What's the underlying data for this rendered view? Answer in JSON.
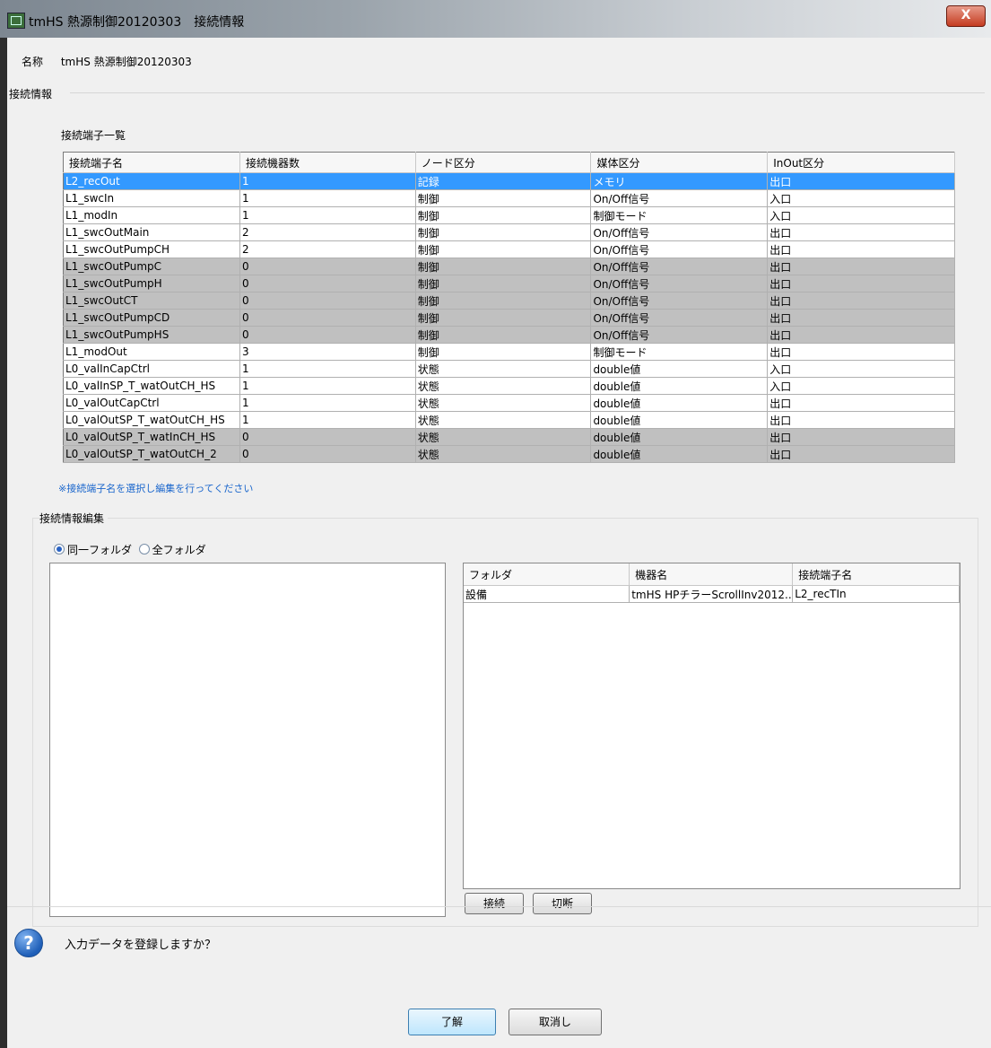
{
  "window": {
    "title": "tmHS 熱源制御20120303　接続情報",
    "close_label": "X"
  },
  "name_row": {
    "label": "名称",
    "value": "tmHS 熱源制御20120303"
  },
  "group_connection_info": "接続情報",
  "terminal_list": {
    "title": "接続端子一覧",
    "columns": [
      "接続端子名",
      "接続機器数",
      "ノード区分",
      "媒体区分",
      "InOut区分"
    ],
    "rows": [
      [
        "L2_recOut",
        "1",
        "記録",
        "メモリ",
        "出口"
      ],
      [
        "L1_swcIn",
        "1",
        "制御",
        "On/Off信号",
        "入口"
      ],
      [
        "L1_modIn",
        "1",
        "制御",
        "制御モード",
        "入口"
      ],
      [
        "L1_swcOutMain",
        "2",
        "制御",
        "On/Off信号",
        "出口"
      ],
      [
        "L1_swcOutPumpCH",
        "2",
        "制御",
        "On/Off信号",
        "出口"
      ],
      [
        "L1_swcOutPumpC",
        "0",
        "制御",
        "On/Off信号",
        "出口"
      ],
      [
        "L1_swcOutPumpH",
        "0",
        "制御",
        "On/Off信号",
        "出口"
      ],
      [
        "L1_swcOutCT",
        "0",
        "制御",
        "On/Off信号",
        "出口"
      ],
      [
        "L1_swcOutPumpCD",
        "0",
        "制御",
        "On/Off信号",
        "出口"
      ],
      [
        "L1_swcOutPumpHS",
        "0",
        "制御",
        "On/Off信号",
        "出口"
      ],
      [
        "L1_modOut",
        "3",
        "制御",
        "制御モード",
        "出口"
      ],
      [
        "L0_valInCapCtrl",
        "1",
        "状態",
        "double値",
        "入口"
      ],
      [
        "L0_valInSP_T_watOutCH_HS",
        "1",
        "状態",
        "double値",
        "入口"
      ],
      [
        "L0_valOutCapCtrl",
        "1",
        "状態",
        "double値",
        "出口"
      ],
      [
        "L0_valOutSP_T_watOutCH_HS",
        "1",
        "状態",
        "double値",
        "出口"
      ],
      [
        "L0_valOutSP_T_watInCH_HS",
        "0",
        "状態",
        "double値",
        "出口"
      ],
      [
        "L0_valOutSP_T_watOutCH_2",
        "0",
        "状態",
        "double値",
        "出口"
      ]
    ],
    "selected_row": 0,
    "gray_rows": [
      5,
      6,
      7,
      8,
      9,
      15,
      16
    ]
  },
  "hint": "※接続端子名を選択し編集を行ってください",
  "edit_section": {
    "title": "接続情報編集",
    "radio_same_folder": "同一フォルダ",
    "radio_all_folder": "全フォルダ",
    "connected": {
      "columns": [
        "フォルダ",
        "機器名",
        "接続端子名"
      ],
      "rows": [
        [
          "設備",
          "tmHS HPチラーScrollInv2012...",
          "L2_recTIn"
        ]
      ]
    },
    "connect_button": "接続",
    "disconnect_button": "切断"
  },
  "footer": {
    "question": "入力データを登録しますか？",
    "ok_button": "了解",
    "cancel_button": "取消し"
  }
}
